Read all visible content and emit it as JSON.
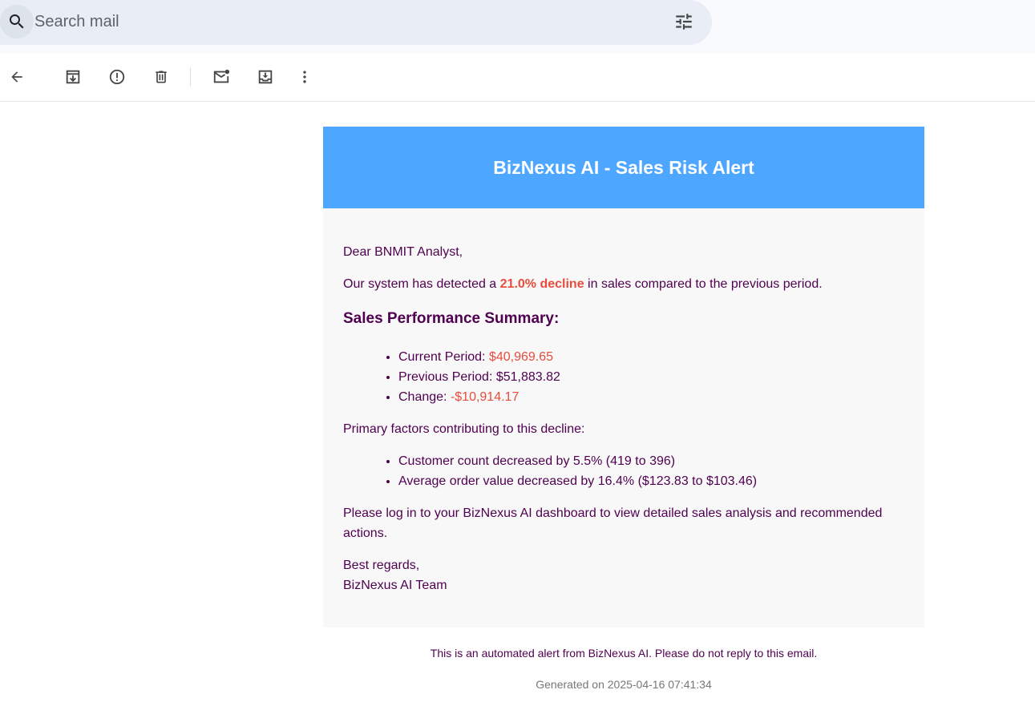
{
  "search": {
    "placeholder": "Search mail",
    "icon": "search-icon",
    "filter_icon": "tune-icon"
  },
  "toolbar": {
    "buttons": [
      "back-icon",
      "archive-icon",
      "report-spam-icon",
      "delete-icon",
      "mark-unread-icon",
      "move-to-icon",
      "more-vert-icon"
    ]
  },
  "email": {
    "header_title": "BizNexus AI - Sales Risk Alert",
    "greeting": "Dear BNMIT Analyst,",
    "intro_prefix": "Our system has detected a ",
    "intro_highlight": "21.0% decline",
    "intro_suffix": " in sales compared to the previous period.",
    "summary_title": "Sales Performance Summary:",
    "summary": [
      {
        "label": "Current Period: ",
        "value": "$40,969.65"
      },
      {
        "label": "Previous Period: ",
        "value": "$51,883.82"
      },
      {
        "label": "Change: ",
        "value": "-$10,914.17"
      }
    ],
    "factors_intro": "Primary factors contributing to this decline:",
    "factors": [
      "Customer count decreased by 5.5% (419 to 396)",
      "Average order value decreased by 16.4% ($123.83 to $103.46)"
    ],
    "cta": "Please log in to your BizNexus AI dashboard to view detailed sales analysis and recommended actions.",
    "signoff": "Best regards,",
    "signature": "BizNexus AI Team",
    "footer_note": "This is an automated alert from BizNexus AI. Please do not reply to this email.",
    "generated": "Generated on 2025-04-16 07:41:34"
  },
  "colors": {
    "header_bg": "#4da6ff",
    "body_text": "#500050",
    "highlight": "#e74c3c"
  }
}
